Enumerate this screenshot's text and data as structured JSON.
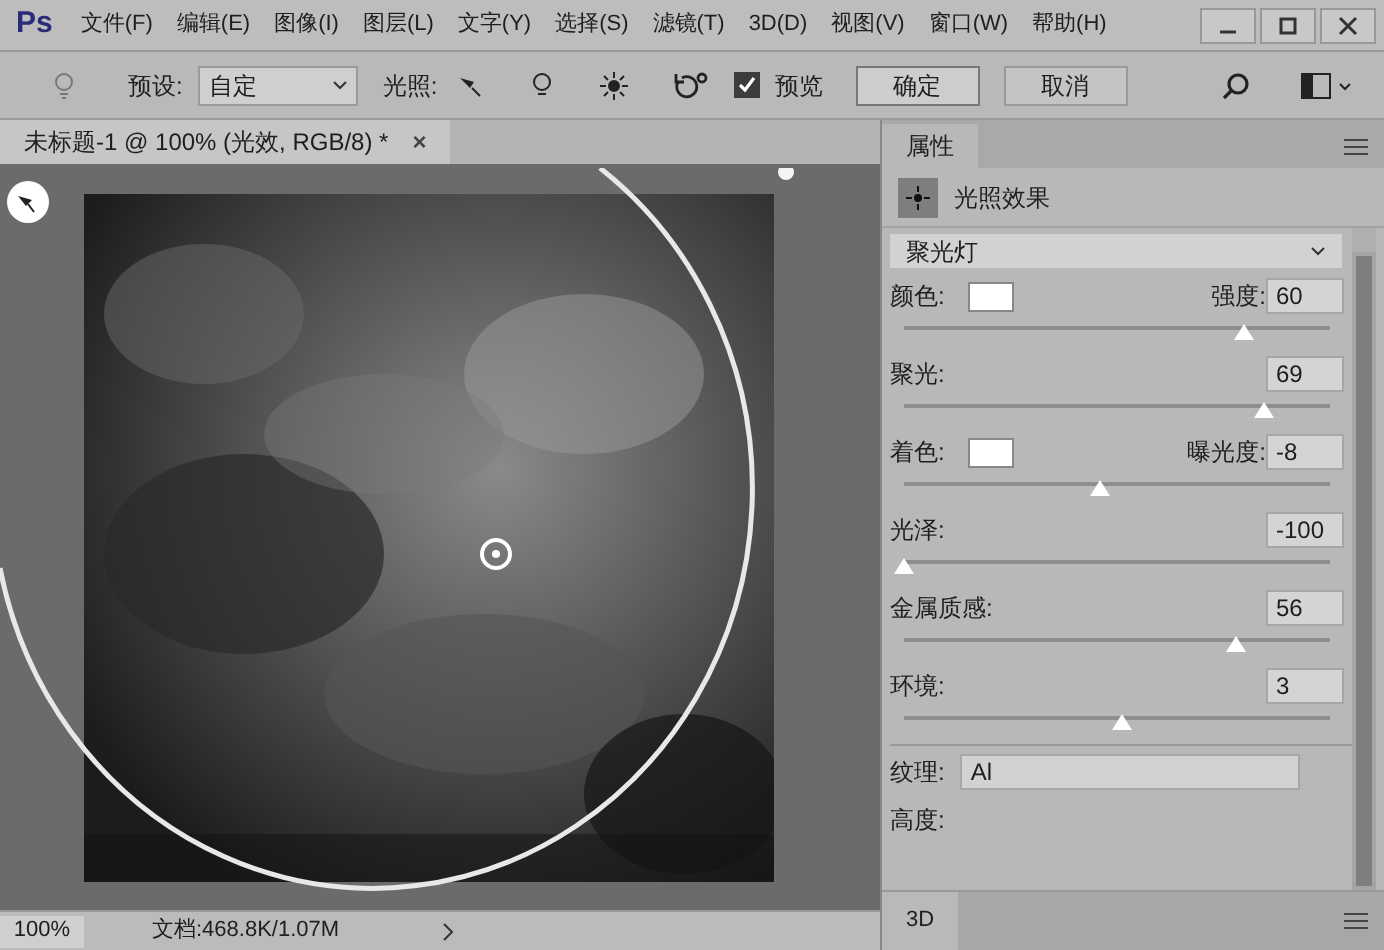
{
  "app_logo": "Ps",
  "menu": [
    "文件(F)",
    "编辑(E)",
    "图像(I)",
    "图层(L)",
    "文字(Y)",
    "选择(S)",
    "滤镜(T)",
    "3D(D)",
    "视图(V)",
    "窗口(W)",
    "帮助(H)"
  ],
  "options_bar": {
    "preset_label": "预设:",
    "preset_value": "自定",
    "lighting_label": "光照:",
    "preview": {
      "label": "预览",
      "checked": true
    },
    "ok": "确定",
    "cancel": "取消"
  },
  "document_tab": {
    "title": "未标题-1 @ 100% (光效, RGB/8) *",
    "close": "×"
  },
  "status_bar": {
    "zoom": "100%",
    "doc_info": "文档:468.8K/1.07M"
  },
  "panel": {
    "tab": "属性",
    "section": "光照效果",
    "light_type": "聚光灯",
    "rows": [
      {
        "kind": "color",
        "label": "颜色:",
        "right_label": "强度:",
        "value": "60",
        "level": 0.8
      },
      {
        "kind": "plain",
        "label": "聚光:",
        "value": "69",
        "level": 0.845
      },
      {
        "kind": "color",
        "label": "着色:",
        "right_label": "曝光度:",
        "value": "-8",
        "level": 0.46
      },
      {
        "kind": "plain",
        "label": "光泽:",
        "value": "-100",
        "level": 0
      },
      {
        "kind": "plain",
        "label": "金属质感:",
        "value": "56",
        "level": 0.78
      },
      {
        "kind": "plain",
        "label": "环境:",
        "value": "3",
        "level": 0.51
      }
    ],
    "texture_label": "纹理:",
    "texture_value": "Al",
    "height_label": "高度:"
  },
  "bottom_tab": "3D"
}
